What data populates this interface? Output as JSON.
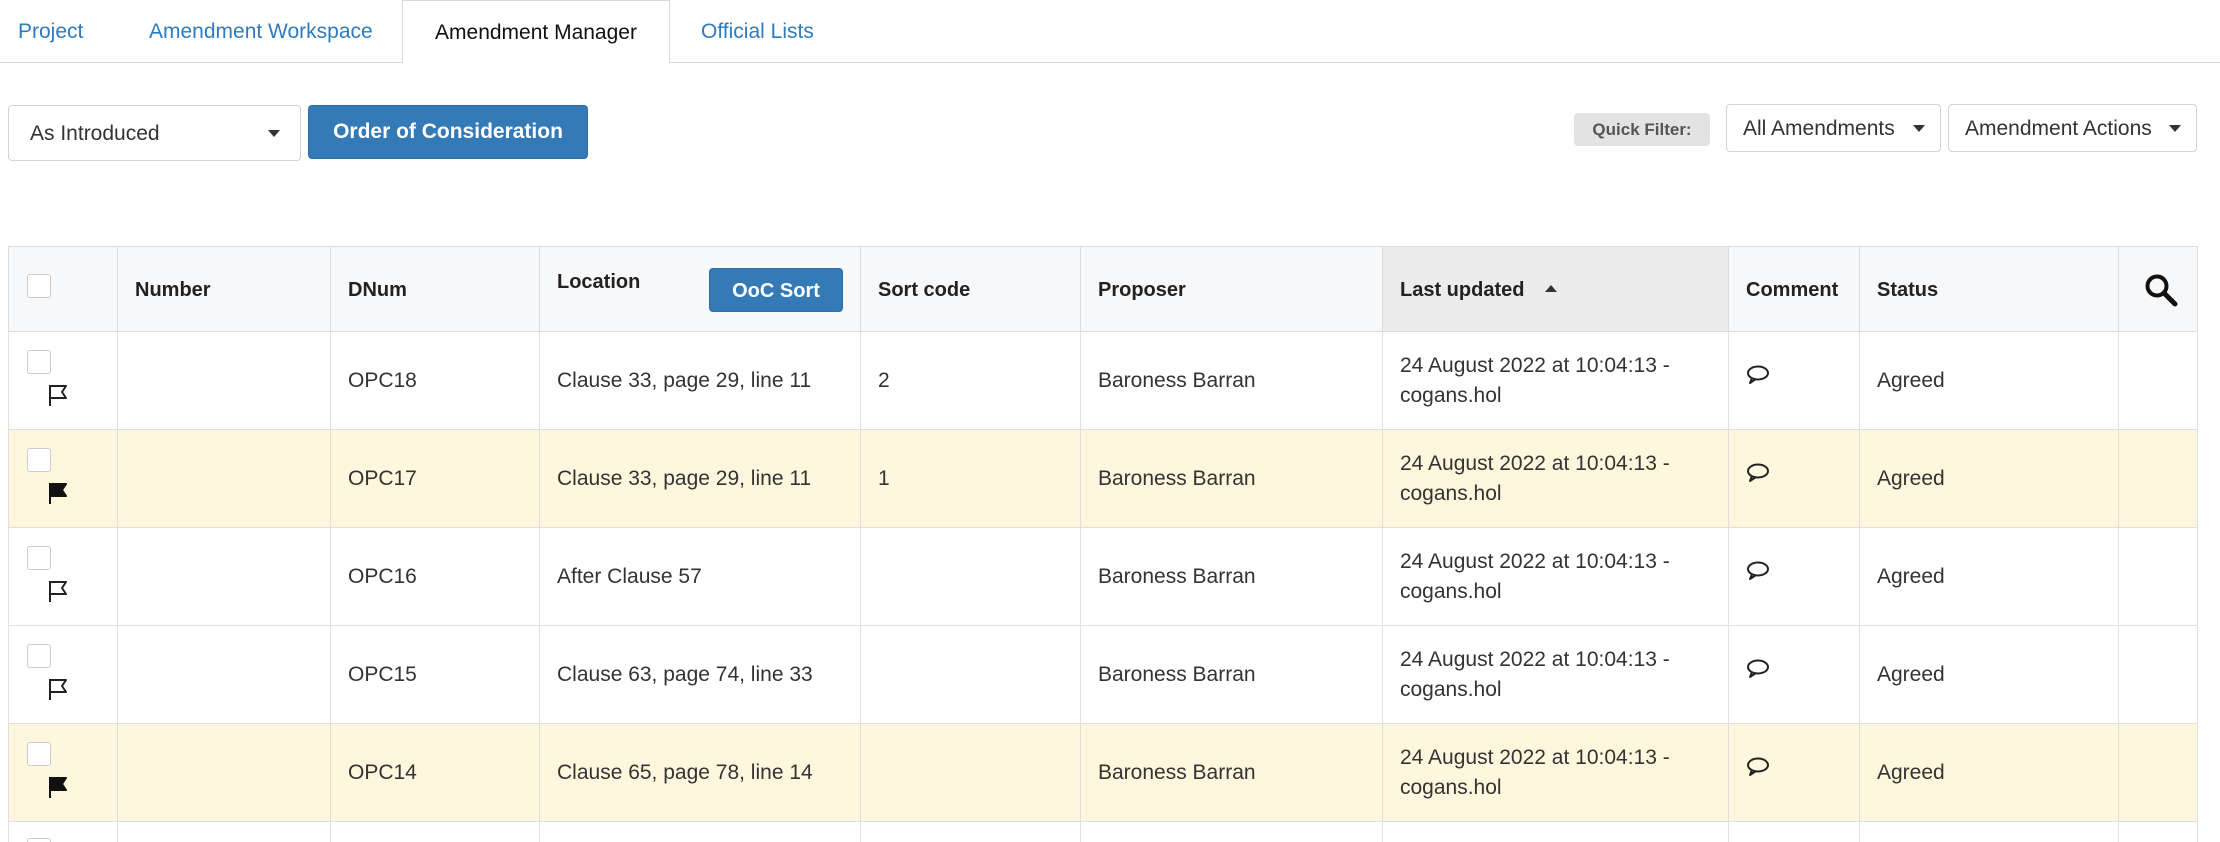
{
  "tabs": [
    {
      "label": "Project"
    },
    {
      "label": "Amendment Workspace"
    },
    {
      "label": "Amendment Manager"
    },
    {
      "label": "Official Lists"
    }
  ],
  "toolbar": {
    "view_select": "As Introduced",
    "ooc_button": "Order of Consideration",
    "quick_filter_label": "Quick Filter:",
    "filter_select": "All Amendments",
    "actions_select": "Amendment Actions"
  },
  "table": {
    "headers": {
      "number": "Number",
      "dnum": "DNum",
      "location": "Location",
      "ooc_sort": "OoC Sort",
      "sort_code": "Sort code",
      "proposer": "Proposer",
      "last_updated": "Last updated",
      "comment": "Comment",
      "status": "Status"
    },
    "rows": [
      {
        "number": "",
        "dnum": "OPC18",
        "location": "Clause 33, page 29, line 11",
        "sort_code": "2",
        "proposer": "Baroness Barran",
        "updated_1": "24 August 2022 at 10:04:13 -",
        "updated_2": "cogans.hol",
        "status": "Agreed",
        "flagged": false
      },
      {
        "number": "",
        "dnum": "OPC17",
        "location": "Clause 33, page 29, line 11",
        "sort_code": "1",
        "proposer": "Baroness Barran",
        "updated_1": "24 August 2022 at 10:04:13 -",
        "updated_2": "cogans.hol",
        "status": "Agreed",
        "flagged": true
      },
      {
        "number": "",
        "dnum": "OPC16",
        "location": "After Clause 57",
        "sort_code": "",
        "proposer": "Baroness Barran",
        "updated_1": "24 August 2022 at 10:04:13 -",
        "updated_2": "cogans.hol",
        "status": "Agreed",
        "flagged": false
      },
      {
        "number": "",
        "dnum": "OPC15",
        "location": "Clause 63, page 74, line 33",
        "sort_code": "",
        "proposer": "Baroness Barran",
        "updated_1": "24 August 2022 at 10:04:13 -",
        "updated_2": "cogans.hol",
        "status": "Agreed",
        "flagged": false
      },
      {
        "number": "",
        "dnum": "OPC14",
        "location": "Clause 65, page 78, line 14",
        "sort_code": "",
        "proposer": "Baroness Barran",
        "updated_1": "24 August 2022 at 10:04:13 -",
        "updated_2": "cogans.hol",
        "status": "Agreed",
        "flagged": true
      }
    ]
  },
  "colors": {
    "accent": "#337ab7",
    "link": "#2f7bbf",
    "highlight_row": "#fef7dd"
  },
  "icons": {
    "flag_outline": "flag-outline-icon",
    "flag_filled": "flag-filled-icon",
    "comment": "comment-icon",
    "search": "search-icon",
    "sort_asc": "sort-ascending-icon",
    "caret": "chevron-down-icon"
  }
}
